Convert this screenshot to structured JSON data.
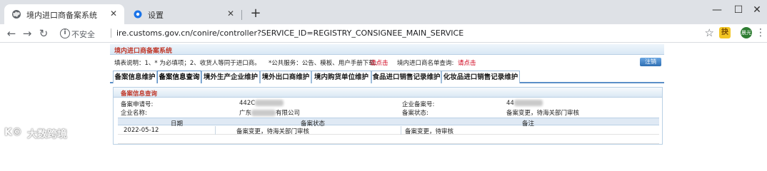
{
  "browser": {
    "tabs": [
      {
        "title": "境内进口商备案系统",
        "favicon": "globe-icon",
        "active": true
      },
      {
        "title": "设置",
        "favicon": "gear-icon",
        "active": false
      }
    ],
    "omnibox": {
      "security_text": "不安全",
      "url": "ire.customs.gov.cn/conire/controller?SERVICE_ID=REGISTRY_CONSIGNEE_MAIN_SERVICE"
    },
    "extension_label": "抉",
    "avatar_label": "晨光",
    "icons": {
      "back": "←",
      "forward": "→",
      "reload": "↻",
      "close": "✕",
      "new_tab": "+",
      "minimize": "—",
      "maximize": "☐",
      "close_window": "✕",
      "star": "☆",
      "menu": "⋮"
    }
  },
  "page": {
    "header_title": "境内进口商备案系统",
    "notice": {
      "text1": "填表说明：1、* 为必填项；2、收货人等同于进口商。",
      "text2": "*公共服务：公告、模板、用户手册下载:",
      "link1": "请点击",
      "text3": "境内进口商名单查询:",
      "link2": "请点击",
      "exit_label": "注销"
    },
    "tabs": [
      "备案信息维护",
      "备案信息查询",
      "境外生产企业维护",
      "境外出口商维护",
      "境内购货单位维护",
      "食品进口销售记录维护",
      "化妆品进口销售记录维护"
    ],
    "active_tab_index": 1,
    "panel": {
      "title": "备案信息查询",
      "fields": {
        "application_no_label": "备案申请号:",
        "application_no_value": "442C",
        "company_no_label": "企业备案号:",
        "company_no_value": "44",
        "company_name_label": "企业名称:",
        "company_name_prefix": "广东",
        "company_name_suffix": "有限公司",
        "status_label": "备案状态:",
        "status_value": "备案变更，待海关部门审核"
      },
      "table": {
        "columns": [
          "日期",
          "备案状态",
          "备注"
        ],
        "rows": [
          [
            "2022-05-12",
            "备案变更，待海关部门审核",
            "备案变更，待审核"
          ]
        ]
      }
    }
  },
  "watermark": {
    "logo": "K©",
    "text": "大数跨境"
  }
}
